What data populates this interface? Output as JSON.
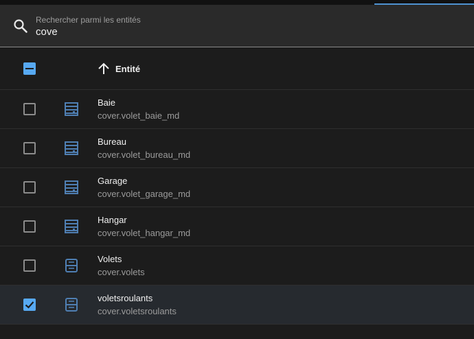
{
  "search": {
    "label": "Rechercher parmi les entités",
    "value": "cove"
  },
  "table": {
    "header": {
      "sort_direction": "ascending",
      "column_label": "Entité",
      "select_all_state": "indeterminate"
    },
    "rows": [
      {
        "name": "Baie",
        "entity_id": "cover.volet_baie_md",
        "icon": "window-shutter-icon",
        "checked": false
      },
      {
        "name": "Bureau",
        "entity_id": "cover.volet_bureau_md",
        "icon": "window-shutter-icon",
        "checked": false
      },
      {
        "name": "Garage",
        "entity_id": "cover.volet_garage_md",
        "icon": "window-shutter-icon",
        "checked": false
      },
      {
        "name": "Hangar",
        "entity_id": "cover.volet_hangar_md",
        "icon": "window-shutter-icon",
        "checked": false
      },
      {
        "name": "Volets",
        "entity_id": "cover.volets",
        "icon": "window-closed-icon",
        "checked": false
      },
      {
        "name": "voletsroulants",
        "entity_id": "cover.voletsroulants",
        "icon": "window-closed-icon",
        "checked": true
      }
    ]
  },
  "colors": {
    "accent": "#57a9f2",
    "icon": "#4f7fb3",
    "background": "#1c1c1c"
  }
}
